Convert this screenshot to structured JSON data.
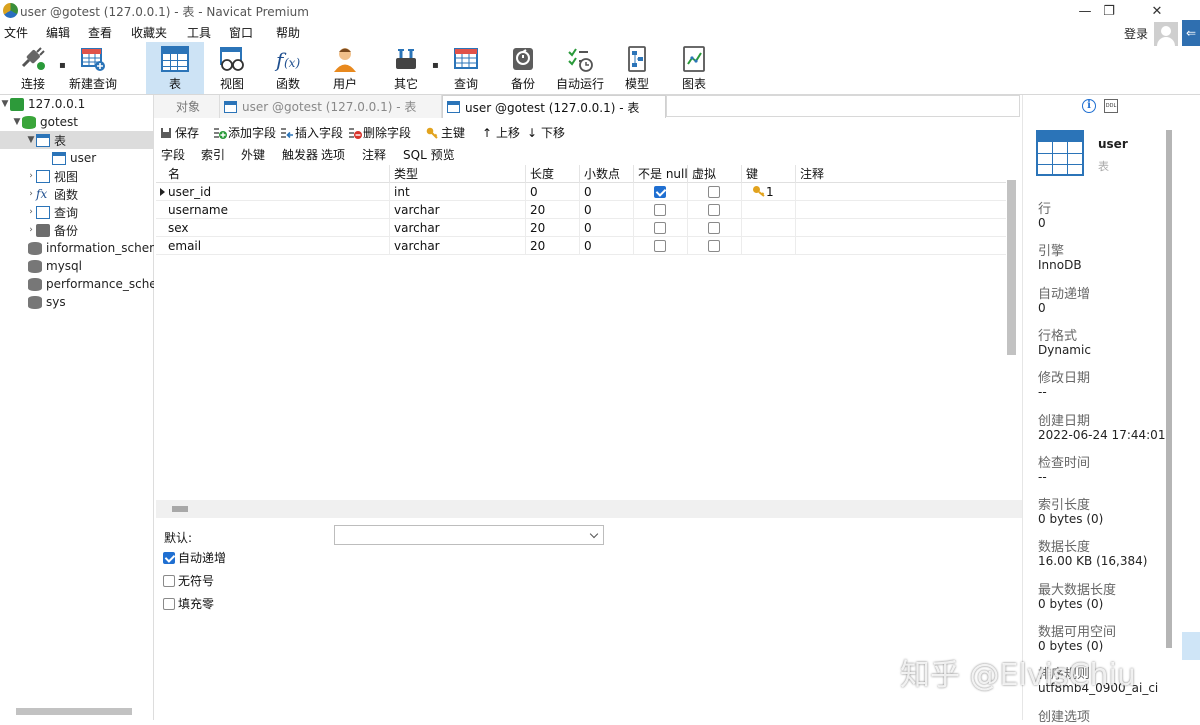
{
  "window": {
    "title": "user @gotest (127.0.0.1) - 表 - Navicat Premium",
    "controls": {
      "minimize": "—",
      "maximize": "❐",
      "close": "✕"
    }
  },
  "menu": [
    "文件",
    "编辑",
    "查看",
    "收藏夹",
    "工具",
    "窗口",
    "帮助"
  ],
  "account": {
    "login_label": "登录"
  },
  "edge": {
    "arrow": "⇐"
  },
  "toolbar": [
    {
      "label": "连接",
      "icon": "connection-icon"
    },
    {
      "label": "新建查询",
      "icon": "new-query-icon"
    },
    {
      "label": "表",
      "icon": "table-icon",
      "active": true
    },
    {
      "label": "视图",
      "icon": "view-icon"
    },
    {
      "label": "函数",
      "icon": "function-icon"
    },
    {
      "label": "用户",
      "icon": "user-icon"
    },
    {
      "label": "其它",
      "icon": "tools-icon"
    },
    {
      "label": "查询",
      "icon": "query-icon"
    },
    {
      "label": "备份",
      "icon": "backup-icon"
    },
    {
      "label": "自动运行",
      "icon": "schedule-icon"
    },
    {
      "label": "模型",
      "icon": "model-icon"
    },
    {
      "label": "图表",
      "icon": "chart-icon"
    }
  ],
  "sidebar": {
    "server": "127.0.0.1",
    "database": "gotest",
    "tables_label": "表",
    "table": "user",
    "views_label": "视图",
    "functions_label": "函数",
    "queries_label": "查询",
    "backups_label": "备份",
    "other_dbs": [
      "information_schema",
      "mysql",
      "performance_schema",
      "sys"
    ]
  },
  "tabs": [
    {
      "label": "对象"
    },
    {
      "label": "user @gotest (127.0.0.1) - 表"
    },
    {
      "label": "user @gotest (127.0.0.1) - 表",
      "active": true
    }
  ],
  "edit_toolbar": {
    "save": "保存",
    "add_field": "添加字段",
    "insert_field": "插入字段",
    "delete_field": "删除字段",
    "primary_key": "主键",
    "move_up": "上移",
    "move_down": "下移"
  },
  "subtabs": [
    "字段",
    "索引",
    "外键",
    "触发器",
    "选项",
    "注释",
    "SQL 预览"
  ],
  "grid": {
    "columns": [
      "名",
      "类型",
      "长度",
      "小数点",
      "不是 null",
      "虚拟",
      "键",
      "注释"
    ],
    "rows": [
      {
        "name": "user_id",
        "type": "int",
        "length": "0",
        "decimals": "0",
        "not_null": true,
        "virtual": false,
        "key": "1"
      },
      {
        "name": "username",
        "type": "varchar",
        "length": "20",
        "decimals": "0",
        "not_null": false,
        "virtual": false,
        "key": ""
      },
      {
        "name": "sex",
        "type": "varchar",
        "length": "20",
        "decimals": "0",
        "not_null": false,
        "virtual": false,
        "key": ""
      },
      {
        "name": "email",
        "type": "varchar",
        "length": "20",
        "decimals": "0",
        "not_null": false,
        "virtual": false,
        "key": ""
      }
    ]
  },
  "field_props": {
    "default_label": "默认:",
    "auto_increment": {
      "label": "自动递增",
      "checked": true
    },
    "unsigned": {
      "label": "无符号",
      "checked": false
    },
    "zerofill": {
      "label": "填充零",
      "checked": false
    }
  },
  "info": {
    "name": "user",
    "type": "表",
    "ddl_label": "DDL",
    "items": [
      {
        "key": "行",
        "value": "0"
      },
      {
        "key": "引擎",
        "value": "InnoDB"
      },
      {
        "key": "自动递增",
        "value": "0"
      },
      {
        "key": "行格式",
        "value": "Dynamic"
      },
      {
        "key": "修改日期",
        "value": "--"
      },
      {
        "key": "创建日期",
        "value": "2022-06-24 17:44:01"
      },
      {
        "key": "检查时间",
        "value": "--"
      },
      {
        "key": "索引长度",
        "value": "0 bytes (0)"
      },
      {
        "key": "数据长度",
        "value": "16.00 KB (16,384)"
      },
      {
        "key": "最大数据长度",
        "value": "0 bytes (0)"
      },
      {
        "key": "数据可用空间",
        "value": "0 bytes (0)"
      },
      {
        "key": "排序规则",
        "value": "utf8mb4_0900_ai_ci"
      },
      {
        "key": "创建选项",
        "value": ""
      }
    ]
  },
  "watermark": "知乎 @ElvisChiu",
  "colors": {
    "accent": "#1f6fd1",
    "table_blue": "#2b74b8",
    "active_toolbar": "#cde3f5"
  }
}
